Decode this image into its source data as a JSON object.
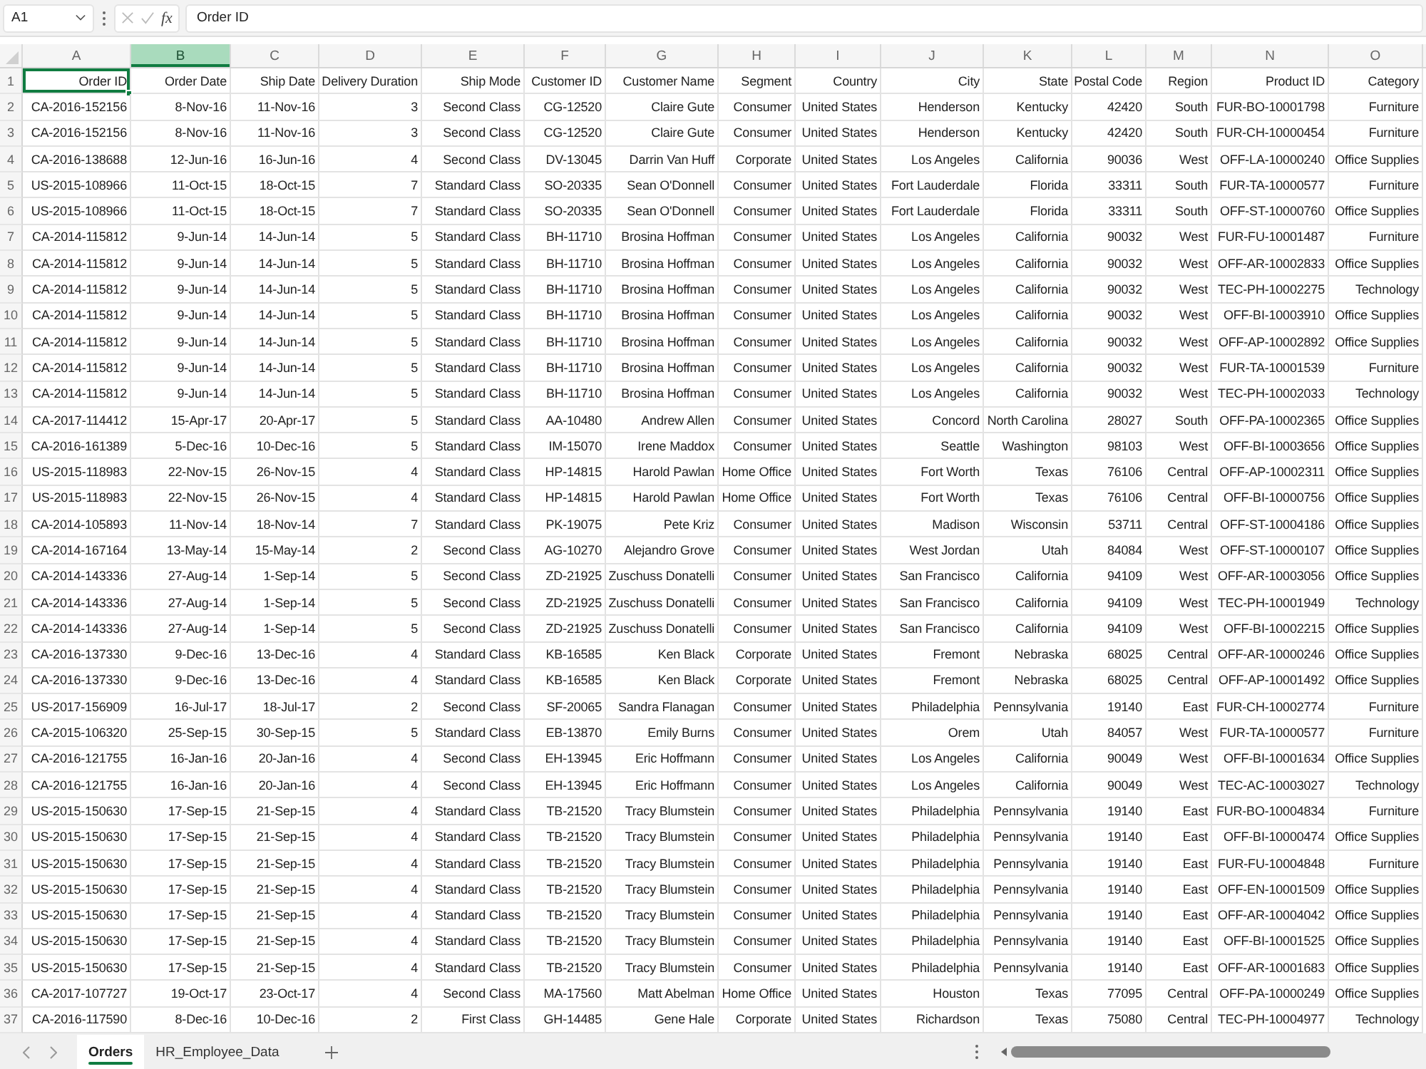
{
  "formula_bar": {
    "name_box": "A1",
    "function_label": "fx",
    "formula": "Order ID"
  },
  "sheet": {
    "columns": [
      {
        "letter": "A",
        "selected": false
      },
      {
        "letter": "B",
        "selected": true
      },
      {
        "letter": "C",
        "selected": false
      },
      {
        "letter": "D",
        "selected": false
      },
      {
        "letter": "E",
        "selected": false
      },
      {
        "letter": "F",
        "selected": false
      },
      {
        "letter": "G",
        "selected": false
      },
      {
        "letter": "H",
        "selected": false
      },
      {
        "letter": "I",
        "selected": false
      },
      {
        "letter": "J",
        "selected": false
      },
      {
        "letter": "K",
        "selected": false
      },
      {
        "letter": "L",
        "selected": false
      },
      {
        "letter": "M",
        "selected": false
      },
      {
        "letter": "N",
        "selected": false
      },
      {
        "letter": "O",
        "selected": false
      }
    ],
    "header_row": {
      "number": "1",
      "cells": [
        {
          "text": "Order ID",
          "selected": true
        },
        {
          "text": "Order Date",
          "selected": false
        },
        {
          "text": "Ship Date",
          "selected": false
        },
        {
          "text": "Delivery Duration",
          "selected": false
        },
        {
          "text": "Ship Mode",
          "selected": false
        },
        {
          "text": "Customer ID",
          "selected": false
        },
        {
          "text": "Customer Name",
          "selected": false
        },
        {
          "text": "Segment",
          "selected": false
        },
        {
          "text": "Country",
          "selected": false
        },
        {
          "text": "City",
          "selected": false
        },
        {
          "text": "State",
          "selected": false
        },
        {
          "text": "Postal Code",
          "selected": false
        },
        {
          "text": "Region",
          "selected": false
        },
        {
          "text": "Product ID",
          "selected": false
        },
        {
          "text": "Category",
          "selected": false
        }
      ]
    },
    "rows": [
      {
        "number": "2",
        "cells": [
          "CA-2016-152156",
          "8-Nov-16",
          "11-Nov-16",
          "3",
          "Second Class",
          "CG-12520",
          "Claire Gute",
          "Consumer",
          "United States",
          "Henderson",
          "Kentucky",
          "42420",
          "South",
          "FUR-BO-10001798",
          "Furniture"
        ]
      },
      {
        "number": "3",
        "cells": [
          "CA-2016-152156",
          "8-Nov-16",
          "11-Nov-16",
          "3",
          "Second Class",
          "CG-12520",
          "Claire Gute",
          "Consumer",
          "United States",
          "Henderson",
          "Kentucky",
          "42420",
          "South",
          "FUR-CH-10000454",
          "Furniture"
        ]
      },
      {
        "number": "4",
        "cells": [
          "CA-2016-138688",
          "12-Jun-16",
          "16-Jun-16",
          "4",
          "Second Class",
          "DV-13045",
          "Darrin Van Huff",
          "Corporate",
          "United States",
          "Los Angeles",
          "California",
          "90036",
          "West",
          "OFF-LA-10000240",
          "Office Supplies"
        ]
      },
      {
        "number": "5",
        "cells": [
          "US-2015-108966",
          "11-Oct-15",
          "18-Oct-15",
          "7",
          "Standard Class",
          "SO-20335",
          "Sean O'Donnell",
          "Consumer",
          "United States",
          "Fort Lauderdale",
          "Florida",
          "33311",
          "South",
          "FUR-TA-10000577",
          "Furniture"
        ]
      },
      {
        "number": "6",
        "cells": [
          "US-2015-108966",
          "11-Oct-15",
          "18-Oct-15",
          "7",
          "Standard Class",
          "SO-20335",
          "Sean O'Donnell",
          "Consumer",
          "United States",
          "Fort Lauderdale",
          "Florida",
          "33311",
          "South",
          "OFF-ST-10000760",
          "Office Supplies"
        ]
      },
      {
        "number": "7",
        "cells": [
          "CA-2014-115812",
          "9-Jun-14",
          "14-Jun-14",
          "5",
          "Standard Class",
          "BH-11710",
          "Brosina Hoffman",
          "Consumer",
          "United States",
          "Los Angeles",
          "California",
          "90032",
          "West",
          "FUR-FU-10001487",
          "Furniture"
        ]
      },
      {
        "number": "8",
        "cells": [
          "CA-2014-115812",
          "9-Jun-14",
          "14-Jun-14",
          "5",
          "Standard Class",
          "BH-11710",
          "Brosina Hoffman",
          "Consumer",
          "United States",
          "Los Angeles",
          "California",
          "90032",
          "West",
          "OFF-AR-10002833",
          "Office Supplies"
        ]
      },
      {
        "number": "9",
        "cells": [
          "CA-2014-115812",
          "9-Jun-14",
          "14-Jun-14",
          "5",
          "Standard Class",
          "BH-11710",
          "Brosina Hoffman",
          "Consumer",
          "United States",
          "Los Angeles",
          "California",
          "90032",
          "West",
          "TEC-PH-10002275",
          "Technology"
        ]
      },
      {
        "number": "10",
        "cells": [
          "CA-2014-115812",
          "9-Jun-14",
          "14-Jun-14",
          "5",
          "Standard Class",
          "BH-11710",
          "Brosina Hoffman",
          "Consumer",
          "United States",
          "Los Angeles",
          "California",
          "90032",
          "West",
          "OFF-BI-10003910",
          "Office Supplies"
        ]
      },
      {
        "number": "11",
        "cells": [
          "CA-2014-115812",
          "9-Jun-14",
          "14-Jun-14",
          "5",
          "Standard Class",
          "BH-11710",
          "Brosina Hoffman",
          "Consumer",
          "United States",
          "Los Angeles",
          "California",
          "90032",
          "West",
          "OFF-AP-10002892",
          "Office Supplies"
        ]
      },
      {
        "number": "12",
        "cells": [
          "CA-2014-115812",
          "9-Jun-14",
          "14-Jun-14",
          "5",
          "Standard Class",
          "BH-11710",
          "Brosina Hoffman",
          "Consumer",
          "United States",
          "Los Angeles",
          "California",
          "90032",
          "West",
          "FUR-TA-10001539",
          "Furniture"
        ]
      },
      {
        "number": "13",
        "cells": [
          "CA-2014-115812",
          "9-Jun-14",
          "14-Jun-14",
          "5",
          "Standard Class",
          "BH-11710",
          "Brosina Hoffman",
          "Consumer",
          "United States",
          "Los Angeles",
          "California",
          "90032",
          "West",
          "TEC-PH-10002033",
          "Technology"
        ]
      },
      {
        "number": "14",
        "cells": [
          "CA-2017-114412",
          "15-Apr-17",
          "20-Apr-17",
          "5",
          "Standard Class",
          "AA-10480",
          "Andrew Allen",
          "Consumer",
          "United States",
          "Concord",
          "North Carolina",
          "28027",
          "South",
          "OFF-PA-10002365",
          "Office Supplies"
        ]
      },
      {
        "number": "15",
        "cells": [
          "CA-2016-161389",
          "5-Dec-16",
          "10-Dec-16",
          "5",
          "Standard Class",
          "IM-15070",
          "Irene Maddox",
          "Consumer",
          "United States",
          "Seattle",
          "Washington",
          "98103",
          "West",
          "OFF-BI-10003656",
          "Office Supplies"
        ]
      },
      {
        "number": "16",
        "cells": [
          "US-2015-118983",
          "22-Nov-15",
          "26-Nov-15",
          "4",
          "Standard Class",
          "HP-14815",
          "Harold Pawlan",
          "Home Office",
          "United States",
          "Fort Worth",
          "Texas",
          "76106",
          "Central",
          "OFF-AP-10002311",
          "Office Supplies"
        ]
      },
      {
        "number": "17",
        "cells": [
          "US-2015-118983",
          "22-Nov-15",
          "26-Nov-15",
          "4",
          "Standard Class",
          "HP-14815",
          "Harold Pawlan",
          "Home Office",
          "United States",
          "Fort Worth",
          "Texas",
          "76106",
          "Central",
          "OFF-BI-10000756",
          "Office Supplies"
        ]
      },
      {
        "number": "18",
        "cells": [
          "CA-2014-105893",
          "11-Nov-14",
          "18-Nov-14",
          "7",
          "Standard Class",
          "PK-19075",
          "Pete Kriz",
          "Consumer",
          "United States",
          "Madison",
          "Wisconsin",
          "53711",
          "Central",
          "OFF-ST-10004186",
          "Office Supplies"
        ]
      },
      {
        "number": "19",
        "cells": [
          "CA-2014-167164",
          "13-May-14",
          "15-May-14",
          "2",
          "Second Class",
          "AG-10270",
          "Alejandro Grove",
          "Consumer",
          "United States",
          "West Jordan",
          "Utah",
          "84084",
          "West",
          "OFF-ST-10000107",
          "Office Supplies"
        ]
      },
      {
        "number": "20",
        "cells": [
          "CA-2014-143336",
          "27-Aug-14",
          "1-Sep-14",
          "5",
          "Second Class",
          "ZD-21925",
          "Zuschuss Donatelli",
          "Consumer",
          "United States",
          "San Francisco",
          "California",
          "94109",
          "West",
          "OFF-AR-10003056",
          "Office Supplies"
        ]
      },
      {
        "number": "21",
        "cells": [
          "CA-2014-143336",
          "27-Aug-14",
          "1-Sep-14",
          "5",
          "Second Class",
          "ZD-21925",
          "Zuschuss Donatelli",
          "Consumer",
          "United States",
          "San Francisco",
          "California",
          "94109",
          "West",
          "TEC-PH-10001949",
          "Technology"
        ]
      },
      {
        "number": "22",
        "cells": [
          "CA-2014-143336",
          "27-Aug-14",
          "1-Sep-14",
          "5",
          "Second Class",
          "ZD-21925",
          "Zuschuss Donatelli",
          "Consumer",
          "United States",
          "San Francisco",
          "California",
          "94109",
          "West",
          "OFF-BI-10002215",
          "Office Supplies"
        ]
      },
      {
        "number": "23",
        "cells": [
          "CA-2016-137330",
          "9-Dec-16",
          "13-Dec-16",
          "4",
          "Standard Class",
          "KB-16585",
          "Ken Black",
          "Corporate",
          "United States",
          "Fremont",
          "Nebraska",
          "68025",
          "Central",
          "OFF-AR-10000246",
          "Office Supplies"
        ]
      },
      {
        "number": "24",
        "cells": [
          "CA-2016-137330",
          "9-Dec-16",
          "13-Dec-16",
          "4",
          "Standard Class",
          "KB-16585",
          "Ken Black",
          "Corporate",
          "United States",
          "Fremont",
          "Nebraska",
          "68025",
          "Central",
          "OFF-AP-10001492",
          "Office Supplies"
        ]
      },
      {
        "number": "25",
        "cells": [
          "US-2017-156909",
          "16-Jul-17",
          "18-Jul-17",
          "2",
          "Second Class",
          "SF-20065",
          "Sandra Flanagan",
          "Consumer",
          "United States",
          "Philadelphia",
          "Pennsylvania",
          "19140",
          "East",
          "FUR-CH-10002774",
          "Furniture"
        ]
      },
      {
        "number": "26",
        "cells": [
          "CA-2015-106320",
          "25-Sep-15",
          "30-Sep-15",
          "5",
          "Standard Class",
          "EB-13870",
          "Emily Burns",
          "Consumer",
          "United States",
          "Orem",
          "Utah",
          "84057",
          "West",
          "FUR-TA-10000577",
          "Furniture"
        ]
      },
      {
        "number": "27",
        "cells": [
          "CA-2016-121755",
          "16-Jan-16",
          "20-Jan-16",
          "4",
          "Second Class",
          "EH-13945",
          "Eric Hoffmann",
          "Consumer",
          "United States",
          "Los Angeles",
          "California",
          "90049",
          "West",
          "OFF-BI-10001634",
          "Office Supplies"
        ]
      },
      {
        "number": "28",
        "cells": [
          "CA-2016-121755",
          "16-Jan-16",
          "20-Jan-16",
          "4",
          "Second Class",
          "EH-13945",
          "Eric Hoffmann",
          "Consumer",
          "United States",
          "Los Angeles",
          "California",
          "90049",
          "West",
          "TEC-AC-10003027",
          "Technology"
        ]
      },
      {
        "number": "29",
        "cells": [
          "US-2015-150630",
          "17-Sep-15",
          "21-Sep-15",
          "4",
          "Standard Class",
          "TB-21520",
          "Tracy Blumstein",
          "Consumer",
          "United States",
          "Philadelphia",
          "Pennsylvania",
          "19140",
          "East",
          "FUR-BO-10004834",
          "Furniture"
        ]
      },
      {
        "number": "30",
        "cells": [
          "US-2015-150630",
          "17-Sep-15",
          "21-Sep-15",
          "4",
          "Standard Class",
          "TB-21520",
          "Tracy Blumstein",
          "Consumer",
          "United States",
          "Philadelphia",
          "Pennsylvania",
          "19140",
          "East",
          "OFF-BI-10000474",
          "Office Supplies"
        ]
      },
      {
        "number": "31",
        "cells": [
          "US-2015-150630",
          "17-Sep-15",
          "21-Sep-15",
          "4",
          "Standard Class",
          "TB-21520",
          "Tracy Blumstein",
          "Consumer",
          "United States",
          "Philadelphia",
          "Pennsylvania",
          "19140",
          "East",
          "FUR-FU-10004848",
          "Furniture"
        ]
      },
      {
        "number": "32",
        "cells": [
          "US-2015-150630",
          "17-Sep-15",
          "21-Sep-15",
          "4",
          "Standard Class",
          "TB-21520",
          "Tracy Blumstein",
          "Consumer",
          "United States",
          "Philadelphia",
          "Pennsylvania",
          "19140",
          "East",
          "OFF-EN-10001509",
          "Office Supplies"
        ]
      },
      {
        "number": "33",
        "cells": [
          "US-2015-150630",
          "17-Sep-15",
          "21-Sep-15",
          "4",
          "Standard Class",
          "TB-21520",
          "Tracy Blumstein",
          "Consumer",
          "United States",
          "Philadelphia",
          "Pennsylvania",
          "19140",
          "East",
          "OFF-AR-10004042",
          "Office Supplies"
        ]
      },
      {
        "number": "34",
        "cells": [
          "US-2015-150630",
          "17-Sep-15",
          "21-Sep-15",
          "4",
          "Standard Class",
          "TB-21520",
          "Tracy Blumstein",
          "Consumer",
          "United States",
          "Philadelphia",
          "Pennsylvania",
          "19140",
          "East",
          "OFF-BI-10001525",
          "Office Supplies"
        ]
      },
      {
        "number": "35",
        "cells": [
          "US-2015-150630",
          "17-Sep-15",
          "21-Sep-15",
          "4",
          "Standard Class",
          "TB-21520",
          "Tracy Blumstein",
          "Consumer",
          "United States",
          "Philadelphia",
          "Pennsylvania",
          "19140",
          "East",
          "OFF-AR-10001683",
          "Office Supplies"
        ]
      },
      {
        "number": "36",
        "cells": [
          "CA-2017-107727",
          "19-Oct-17",
          "23-Oct-17",
          "4",
          "Second Class",
          "MA-17560",
          "Matt Abelman",
          "Home Office",
          "United States",
          "Houston",
          "Texas",
          "77095",
          "Central",
          "OFF-PA-10000249",
          "Office Supplies"
        ]
      },
      {
        "number": "37",
        "cells": [
          "CA-2016-117590",
          "8-Dec-16",
          "10-Dec-16",
          "2",
          "First Class",
          "GH-14485",
          "Gene Hale",
          "Corporate",
          "United States",
          "Richardson",
          "Texas",
          "75080",
          "Central",
          "TEC-PH-10004977",
          "Technology"
        ]
      }
    ]
  },
  "sheet_tabs": [
    {
      "label": "Orders",
      "selected": true
    },
    {
      "label": "HR_Employee_Data",
      "selected": false
    }
  ]
}
